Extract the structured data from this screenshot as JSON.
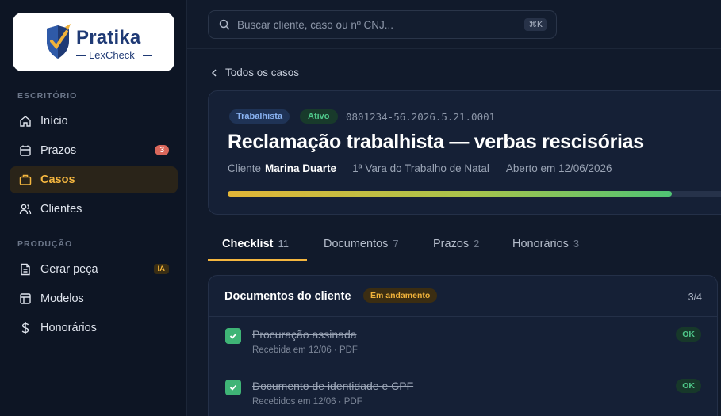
{
  "brand": {
    "name": "Pratika",
    "product": "LexCheck"
  },
  "search": {
    "placeholder": "Buscar cliente, caso ou nº CNJ...",
    "shortcut": "⌘K"
  },
  "sidebar": {
    "section1": "ESCRITÓRIO",
    "section2": "PRODUÇÃO",
    "items": [
      {
        "label": "Início",
        "icon": "home-icon"
      },
      {
        "label": "Prazos",
        "icon": "calendar-icon",
        "badge": "3"
      },
      {
        "label": "Casos",
        "icon": "briefcase-icon",
        "active": true
      },
      {
        "label": "Clientes",
        "icon": "users-icon"
      },
      {
        "label": "Gerar peça",
        "icon": "document-icon",
        "badge": "IA"
      },
      {
        "label": "Modelos",
        "icon": "layout-icon"
      },
      {
        "label": "Honorários",
        "icon": "dollar-icon"
      }
    ]
  },
  "breadcrumb": {
    "back_label": "Todos os casos"
  },
  "case": {
    "area_tag": "Trabalhista",
    "status_tag": "Ativo",
    "cnj": "0801234-56.2026.5.21.0001",
    "title": "Reclamação trabalhista — verbas rescisórias",
    "client_label": "Cliente",
    "client_name": "Marina Duarte",
    "court": "1ª Vara do Trabalho de Natal",
    "opened": "Aberto em 12/06/2026",
    "progress_fraction": 0.88
  },
  "tabs": [
    {
      "label": "Checklist",
      "count": "11",
      "active": true
    },
    {
      "label": "Documentos",
      "count": "7"
    },
    {
      "label": "Prazos",
      "count": "2"
    },
    {
      "label": "Honorários",
      "count": "3"
    }
  ],
  "checklist": {
    "group_title": "Documentos do cliente",
    "group_status": "Em andamento",
    "group_count": "3/4",
    "items": [
      {
        "title": "Procuração assinada",
        "sub": "Recebida em 12/06 · PDF",
        "status": "OK"
      },
      {
        "title": "Documento de identidade e CPF",
        "sub": "Recebidos em 12/06 · PDF",
        "status": "OK"
      }
    ]
  },
  "colors": {
    "accent": "#f4b63f",
    "success": "#3fb476",
    "danger": "#d9675b",
    "background": "#111a2b"
  }
}
